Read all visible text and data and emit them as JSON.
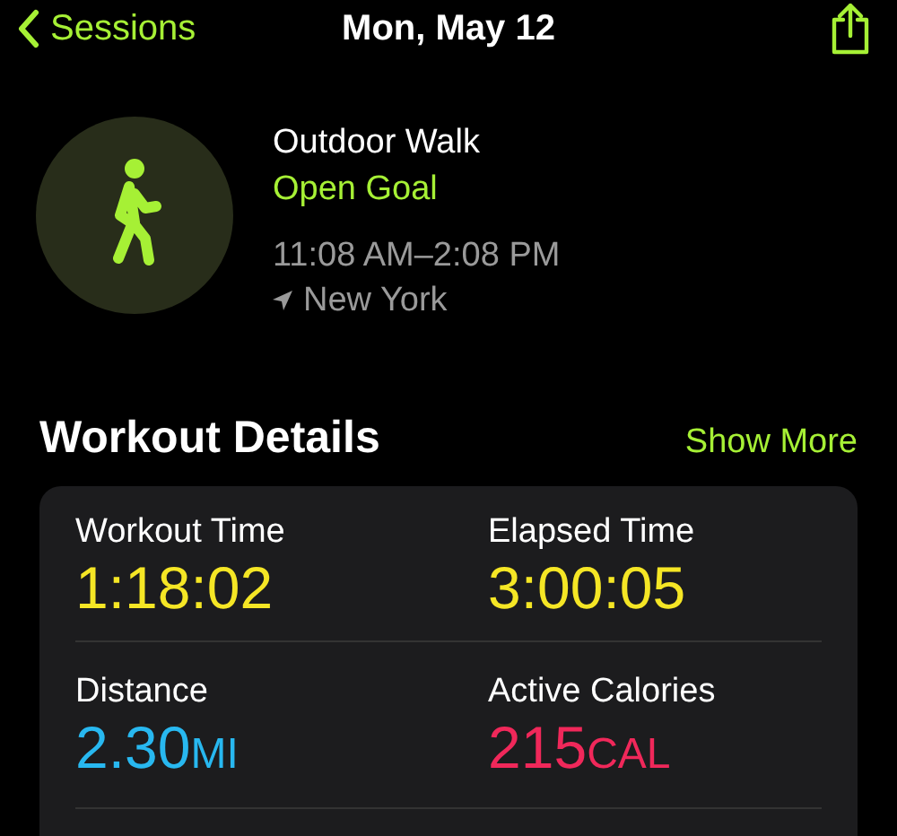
{
  "nav": {
    "back_label": "Sessions",
    "title": "Mon, May 12"
  },
  "workout": {
    "name": "Outdoor Walk",
    "goal": "Open Goal",
    "time_range": "11:08 AM–2:08 PM",
    "location": "New York"
  },
  "details": {
    "title": "Workout Details",
    "action": "Show More",
    "metrics": [
      {
        "label": "Workout Time",
        "value": "1:18:02",
        "color": "#f5e625"
      },
      {
        "label": "Elapsed Time",
        "value": "3:00:05",
        "color": "#f5e625"
      },
      {
        "label": "Distance",
        "value": "2.30",
        "unit": "MI",
        "color": "#28b8f0"
      },
      {
        "label": "Active Calories",
        "value": "215",
        "unit": "CAL",
        "color": "#f0285a"
      }
    ]
  }
}
